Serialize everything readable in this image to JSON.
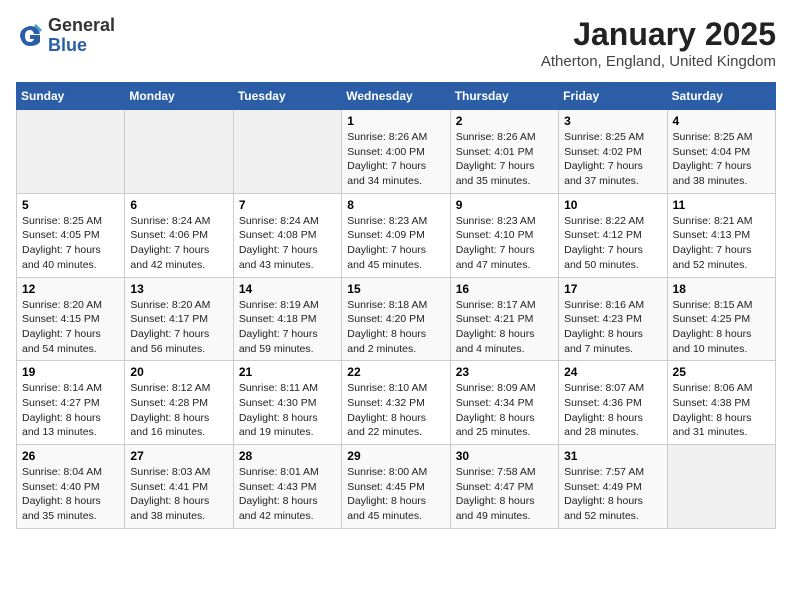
{
  "logo": {
    "general": "General",
    "blue": "Blue"
  },
  "title": "January 2025",
  "subtitle": "Atherton, England, United Kingdom",
  "days_of_week": [
    "Sunday",
    "Monday",
    "Tuesday",
    "Wednesday",
    "Thursday",
    "Friday",
    "Saturday"
  ],
  "weeks": [
    [
      {
        "day": "",
        "info": ""
      },
      {
        "day": "",
        "info": ""
      },
      {
        "day": "",
        "info": ""
      },
      {
        "day": "1",
        "info": "Sunrise: 8:26 AM\nSunset: 4:00 PM\nDaylight: 7 hours\nand 34 minutes."
      },
      {
        "day": "2",
        "info": "Sunrise: 8:26 AM\nSunset: 4:01 PM\nDaylight: 7 hours\nand 35 minutes."
      },
      {
        "day": "3",
        "info": "Sunrise: 8:25 AM\nSunset: 4:02 PM\nDaylight: 7 hours\nand 37 minutes."
      },
      {
        "day": "4",
        "info": "Sunrise: 8:25 AM\nSunset: 4:04 PM\nDaylight: 7 hours\nand 38 minutes."
      }
    ],
    [
      {
        "day": "5",
        "info": "Sunrise: 8:25 AM\nSunset: 4:05 PM\nDaylight: 7 hours\nand 40 minutes."
      },
      {
        "day": "6",
        "info": "Sunrise: 8:24 AM\nSunset: 4:06 PM\nDaylight: 7 hours\nand 42 minutes."
      },
      {
        "day": "7",
        "info": "Sunrise: 8:24 AM\nSunset: 4:08 PM\nDaylight: 7 hours\nand 43 minutes."
      },
      {
        "day": "8",
        "info": "Sunrise: 8:23 AM\nSunset: 4:09 PM\nDaylight: 7 hours\nand 45 minutes."
      },
      {
        "day": "9",
        "info": "Sunrise: 8:23 AM\nSunset: 4:10 PM\nDaylight: 7 hours\nand 47 minutes."
      },
      {
        "day": "10",
        "info": "Sunrise: 8:22 AM\nSunset: 4:12 PM\nDaylight: 7 hours\nand 50 minutes."
      },
      {
        "day": "11",
        "info": "Sunrise: 8:21 AM\nSunset: 4:13 PM\nDaylight: 7 hours\nand 52 minutes."
      }
    ],
    [
      {
        "day": "12",
        "info": "Sunrise: 8:20 AM\nSunset: 4:15 PM\nDaylight: 7 hours\nand 54 minutes."
      },
      {
        "day": "13",
        "info": "Sunrise: 8:20 AM\nSunset: 4:17 PM\nDaylight: 7 hours\nand 56 minutes."
      },
      {
        "day": "14",
        "info": "Sunrise: 8:19 AM\nSunset: 4:18 PM\nDaylight: 7 hours\nand 59 minutes."
      },
      {
        "day": "15",
        "info": "Sunrise: 8:18 AM\nSunset: 4:20 PM\nDaylight: 8 hours\nand 2 minutes."
      },
      {
        "day": "16",
        "info": "Sunrise: 8:17 AM\nSunset: 4:21 PM\nDaylight: 8 hours\nand 4 minutes."
      },
      {
        "day": "17",
        "info": "Sunrise: 8:16 AM\nSunset: 4:23 PM\nDaylight: 8 hours\nand 7 minutes."
      },
      {
        "day": "18",
        "info": "Sunrise: 8:15 AM\nSunset: 4:25 PM\nDaylight: 8 hours\nand 10 minutes."
      }
    ],
    [
      {
        "day": "19",
        "info": "Sunrise: 8:14 AM\nSunset: 4:27 PM\nDaylight: 8 hours\nand 13 minutes."
      },
      {
        "day": "20",
        "info": "Sunrise: 8:12 AM\nSunset: 4:28 PM\nDaylight: 8 hours\nand 16 minutes."
      },
      {
        "day": "21",
        "info": "Sunrise: 8:11 AM\nSunset: 4:30 PM\nDaylight: 8 hours\nand 19 minutes."
      },
      {
        "day": "22",
        "info": "Sunrise: 8:10 AM\nSunset: 4:32 PM\nDaylight: 8 hours\nand 22 minutes."
      },
      {
        "day": "23",
        "info": "Sunrise: 8:09 AM\nSunset: 4:34 PM\nDaylight: 8 hours\nand 25 minutes."
      },
      {
        "day": "24",
        "info": "Sunrise: 8:07 AM\nSunset: 4:36 PM\nDaylight: 8 hours\nand 28 minutes."
      },
      {
        "day": "25",
        "info": "Sunrise: 8:06 AM\nSunset: 4:38 PM\nDaylight: 8 hours\nand 31 minutes."
      }
    ],
    [
      {
        "day": "26",
        "info": "Sunrise: 8:04 AM\nSunset: 4:40 PM\nDaylight: 8 hours\nand 35 minutes."
      },
      {
        "day": "27",
        "info": "Sunrise: 8:03 AM\nSunset: 4:41 PM\nDaylight: 8 hours\nand 38 minutes."
      },
      {
        "day": "28",
        "info": "Sunrise: 8:01 AM\nSunset: 4:43 PM\nDaylight: 8 hours\nand 42 minutes."
      },
      {
        "day": "29",
        "info": "Sunrise: 8:00 AM\nSunset: 4:45 PM\nDaylight: 8 hours\nand 45 minutes."
      },
      {
        "day": "30",
        "info": "Sunrise: 7:58 AM\nSunset: 4:47 PM\nDaylight: 8 hours\nand 49 minutes."
      },
      {
        "day": "31",
        "info": "Sunrise: 7:57 AM\nSunset: 4:49 PM\nDaylight: 8 hours\nand 52 minutes."
      },
      {
        "day": "",
        "info": ""
      }
    ]
  ]
}
